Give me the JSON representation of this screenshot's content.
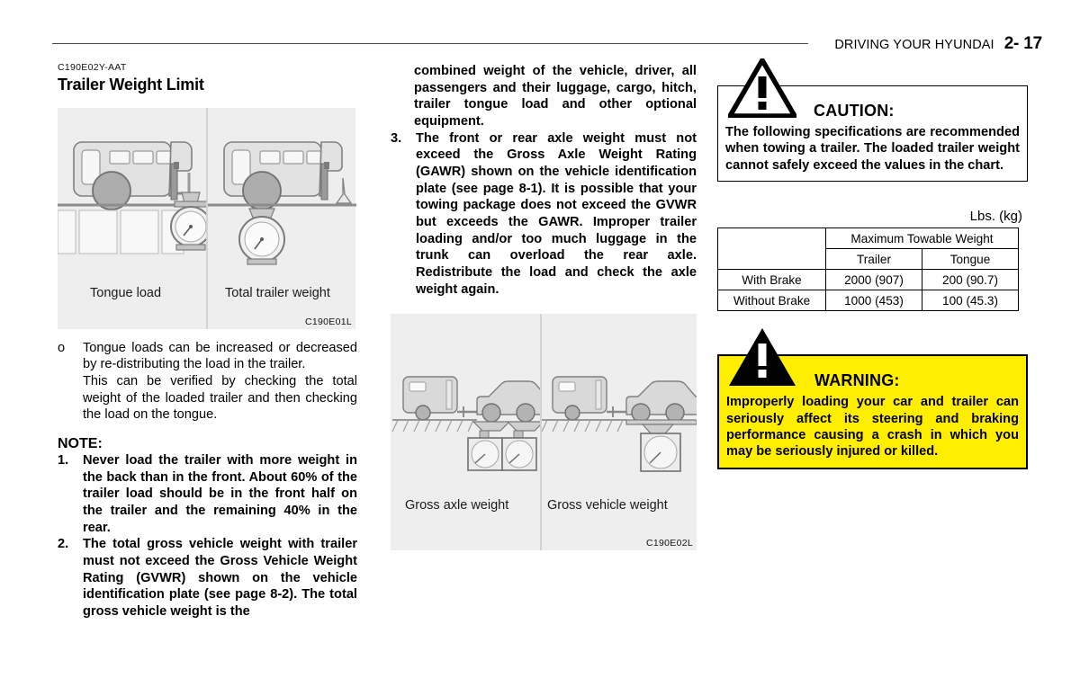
{
  "header": {
    "title": "DRIVING YOUR HYUNDAI",
    "page_number": "2- 17"
  },
  "left_column": {
    "section_code": "C190E02Y-AAT",
    "section_title": "Trailer Weight Limit",
    "figure": {
      "ref": "C190E01L",
      "caption_left": "Tongue load",
      "caption_right": "Total trailer weight"
    },
    "bullet": {
      "marker": "o",
      "paragraph1": "Tongue loads can be increased or decreased by re-distributing the load in the trailer.",
      "paragraph2": "This can be verified by checking the total weight of the loaded trailer and then checking the load on the tongue."
    },
    "note_heading": "NOTE:",
    "notes": [
      {
        "marker": "1.",
        "text": "Never load the trailer with more weight in the back than in the front. About 60% of the trailer load should be in the front half on the trailer and the remaining 40% in the rear."
      },
      {
        "marker": "2.",
        "text": "The total gross vehicle weight with trailer must not exceed the Gross Vehicle Weight Rating (GVWR) shown on the vehicle identification plate (see page 8-2). The total gross vehicle weight is the"
      }
    ]
  },
  "middle_column": {
    "continuation": "combined weight of the vehicle, driver, all passengers and their luggage, cargo, hitch, trailer tongue load and other optional equipment.",
    "note3": {
      "marker": "3.",
      "text": "The front or rear axle weight must not exceed the Gross Axle Weight Rating (GAWR) shown on the vehicle identification plate (see page 8-1). It is possible that your towing package does not exceed the GVWR but exceeds the GAWR. Improper trailer loading and/or too much luggage in the trunk can overload the rear axle. Redistribute the load and check the axle weight again."
    },
    "figure": {
      "ref": "C190E02L",
      "caption_left": "Gross axle weight",
      "caption_right": "Gross vehicle weight"
    }
  },
  "right_column": {
    "caution": {
      "icon": "warning-triangle-outline-icon",
      "title": "CAUTION:",
      "text": "The following specifications are recommended when towing a trailer. The loaded trailer weight cannot safely exceed the values in the chart."
    },
    "table": {
      "units_label": "Lbs.  (kg)",
      "group_header": "Maximum Towable Weight",
      "sub_headers": [
        "Trailer",
        "Tongue"
      ],
      "rows": [
        {
          "label": "With Brake",
          "trailer": "2000 (907)",
          "tongue": "200 (90.7)"
        },
        {
          "label": "Without Brake",
          "trailer": "1000 (453)",
          "tongue": "100 (45.3)"
        }
      ]
    },
    "warning": {
      "icon": "warning-triangle-solid-icon",
      "title": "WARNING:",
      "text": "Improperly loading your car and trailer can seriously affect its steering and braking performance causing a crash in which you may be seriously injured or killed.",
      "background_color": "#ffee00"
    }
  }
}
